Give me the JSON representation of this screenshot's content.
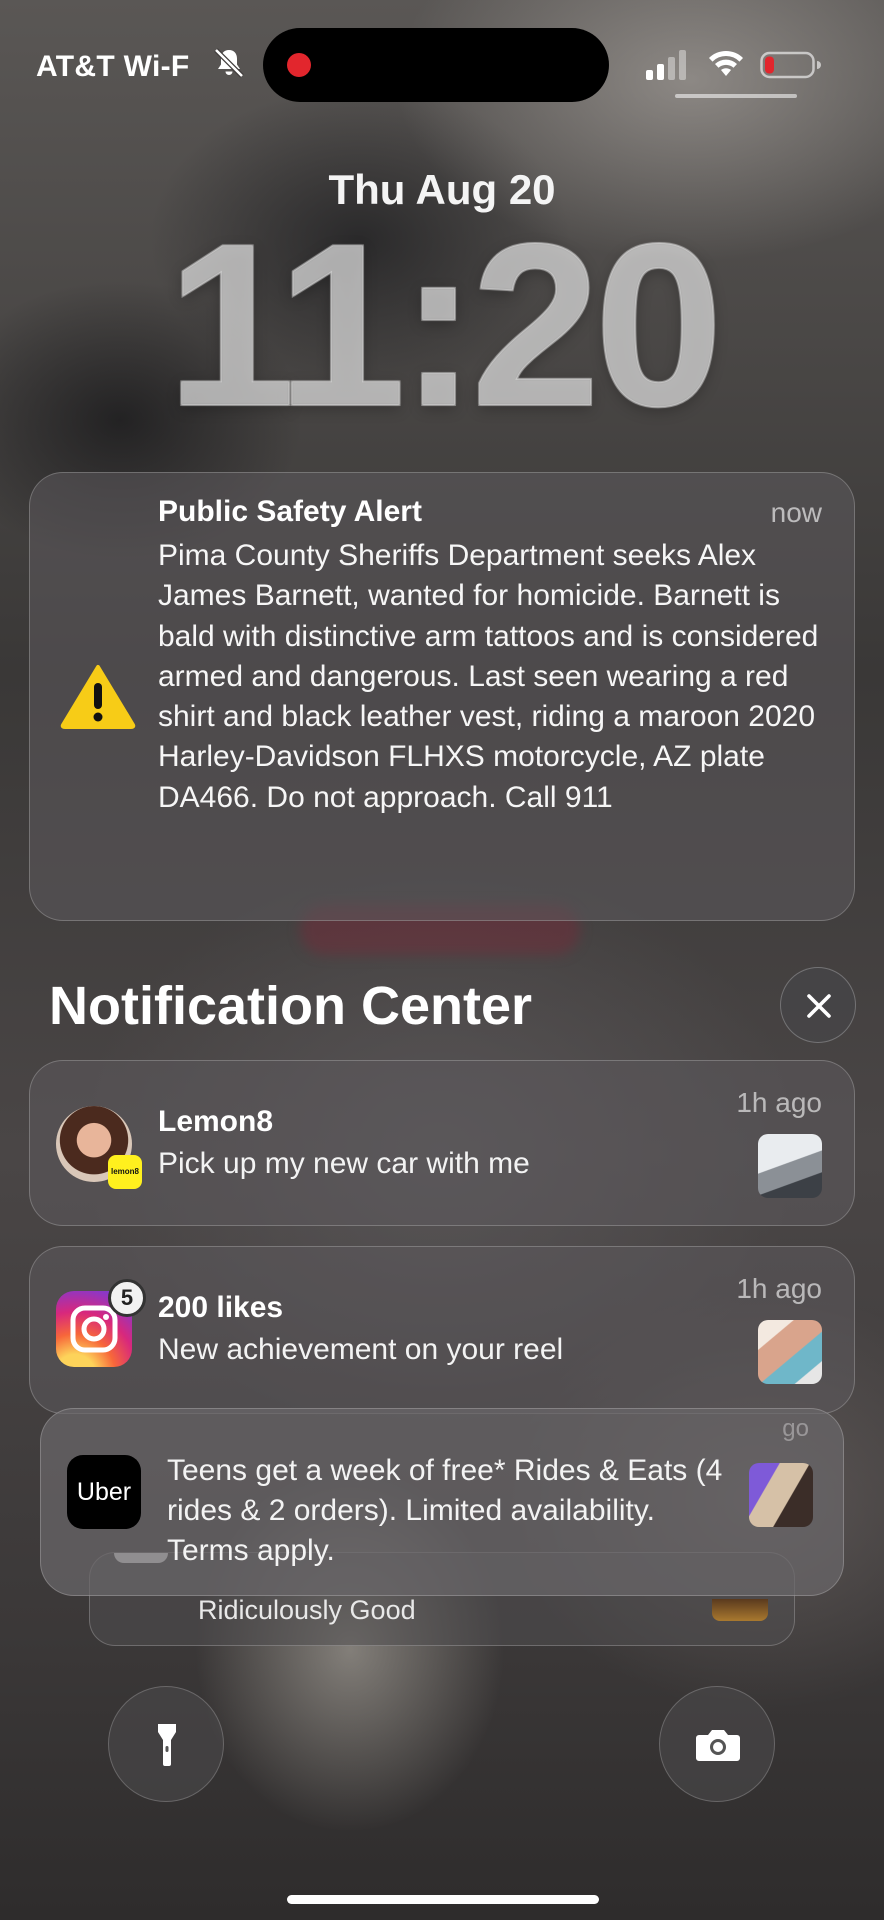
{
  "status_bar": {
    "carrier": "AT&T Wi-F",
    "icons": [
      "bell-slash-icon",
      "recording-dot",
      "cellular-signal-icon",
      "wifi-icon",
      "battery-low-icon"
    ],
    "battery_color": "#e2262d"
  },
  "lock_screen": {
    "date": "Thu Aug 20",
    "time": "11:20"
  },
  "alert": {
    "title": "Public Safety Alert",
    "time": "now",
    "icon": "warning-icon",
    "icon_color": "#f7cc17",
    "body": "Pima County Sheriffs Department seeks Alex James Barnett, wanted for homicide. Barnett is bald with distinctive arm tattoos and is considered armed and dangerous. Last seen wearing a red shirt and black leather vest, riding a maroon 2020 Harley-Davidson FLHXS motorcycle, AZ plate DA466. Do not approach. Call 911"
  },
  "notification_center": {
    "title": "Notification Center",
    "close_icon": "close-icon"
  },
  "notifications": [
    {
      "app": "Lemon8",
      "title": "Lemon8",
      "body": "Pick up my new car with me",
      "time": "1h ago",
      "badge_label": "lemon8"
    },
    {
      "app": "Instagram",
      "title": "200 likes",
      "body": "New achievement on your reel",
      "time": "1h ago",
      "badge_count": "5"
    },
    {
      "app": "Uber",
      "icon_label": "Uber",
      "body": "Teens get a week of free* Rides & Eats (4 rides & 2 orders). Limited availability. Terms apply.",
      "time_partial": "go"
    }
  ],
  "stacked_behind": {
    "body": "Ridiculously Good"
  },
  "bottom_controls": {
    "left": "flashlight-icon",
    "right": "camera-icon"
  }
}
